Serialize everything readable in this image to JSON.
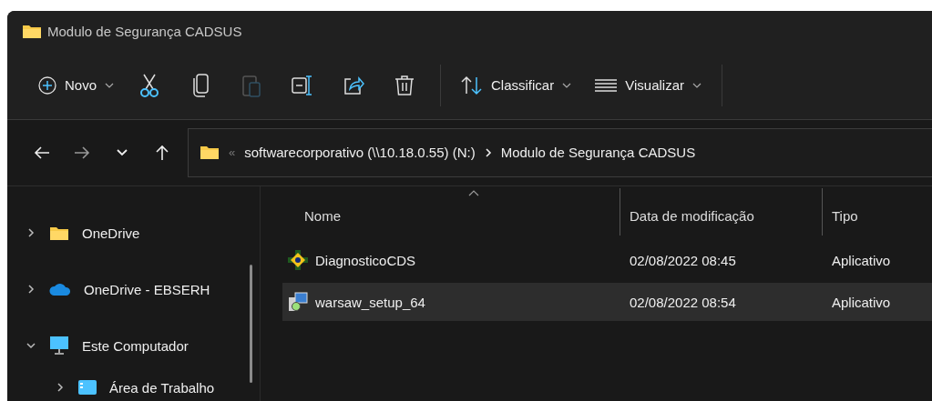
{
  "window": {
    "title": "Modulo de Segurança CADSUS"
  },
  "toolbar": [
    {
      "kind": "menu",
      "label": "Novo"
    },
    {
      "kind": "icon",
      "disabled": false
    },
    {
      "kind": "icon",
      "disabled": false
    },
    {
      "kind": "icon",
      "disabled": true
    },
    {
      "kind": "icon",
      "disabled": false
    },
    {
      "kind": "icon",
      "disabled": false
    },
    {
      "kind": "icon",
      "disabled": false
    },
    {
      "kind": "separator"
    },
    {
      "kind": "menu",
      "label": "Classificar"
    },
    {
      "kind": "menu",
      "label": "Visualizar"
    },
    {
      "kind": "separator"
    }
  ],
  "address_bar": {
    "overflow": "«",
    "segments": [
      "softwarecorporativo (\\\\10.18.0.55) (N:)",
      "Modulo de Segurança CADSUS"
    ]
  },
  "sidebar": {
    "items": [
      {
        "label": "OneDrive",
        "expanded": false
      },
      {
        "label": "OneDrive - EBSERH",
        "expanded": false
      },
      {
        "label": "Este Computador",
        "expanded": true,
        "children": [
          {
            "label": "Área de Trabalho",
            "expanded": false
          }
        ]
      }
    ]
  },
  "table": {
    "columns": [
      {
        "label": "Nome",
        "sorted": true
      },
      {
        "label": "Data de modificação",
        "sorted": false
      },
      {
        "label": "Tipo",
        "sorted": false
      }
    ],
    "rows": [
      {
        "name": "DiagnosticoCDS",
        "date": "02/08/2022 08:45",
        "type": "Aplicativo",
        "selected": false
      },
      {
        "name": "warsaw_setup_64",
        "date": "02/08/2022 08:54",
        "type": "Aplicativo",
        "selected": true
      }
    ]
  }
}
